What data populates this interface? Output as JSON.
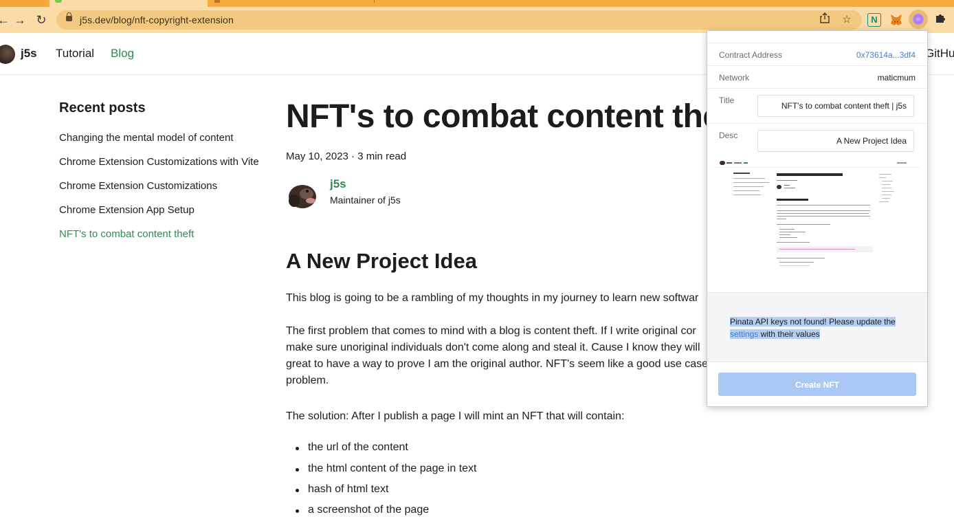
{
  "browser": {
    "url": "j5s.dev/blog/nft-copyright-extension"
  },
  "site": {
    "name": "j5s",
    "nav": [
      "Tutorial",
      "Blog"
    ],
    "github_partial": "GitHul"
  },
  "sidebar": {
    "title": "Recent posts",
    "posts": [
      "Changing the mental model of content",
      "Chrome Extension Customizations with Vite",
      "Chrome Extension Customizations",
      "Chrome Extension App Setup",
      "NFT's to combat content theft"
    ]
  },
  "article": {
    "title": "NFT's to combat content theft",
    "meta": "May 10, 2023 · 3 min read",
    "author_name": "j5s",
    "author_role": "Maintainer of j5s",
    "section_title": "A New Project Idea",
    "p1": "This blog is going to be a rambling of my thoughts in my journey to learn new softwar",
    "p2_lines": [
      "The first problem that comes to mind with a blog is content theft. If I write original cor",
      "make sure unoriginal individuals don't come along and steal it. Cause I know they will",
      "great to have a way to prove I am the original author. NFT's seem like a good use case",
      "problem."
    ],
    "p3": "The solution: After I publish a page I will mint an NFT that will contain:",
    "bullets": [
      "the url of the content",
      "the html content of the page in text",
      "hash of html text",
      "a screenshot of the page"
    ]
  },
  "popup": {
    "contract_label": "Contract Address",
    "contract_value": "0x73614a...3df4",
    "network_label": "Network",
    "network_value": "maticmum",
    "title_label": "Title",
    "title_value": "NFT's to combat content theft | j5s",
    "desc_label": "Desc",
    "desc_value": "A New Project Idea",
    "warning_pre": "Pinata API keys not found! Please update the",
    "warning_link": "settings",
    "warning_post": "with their values",
    "create_label": "Create NFT",
    "colors": {
      "link": "#3d7fd6",
      "button": "#a9c8f6",
      "selection": "#b4cdf2"
    }
  },
  "colors": {
    "accent_green": "#2f8a52",
    "toolbar": "#fbdca6",
    "tabstrip": "#f7a93a"
  }
}
